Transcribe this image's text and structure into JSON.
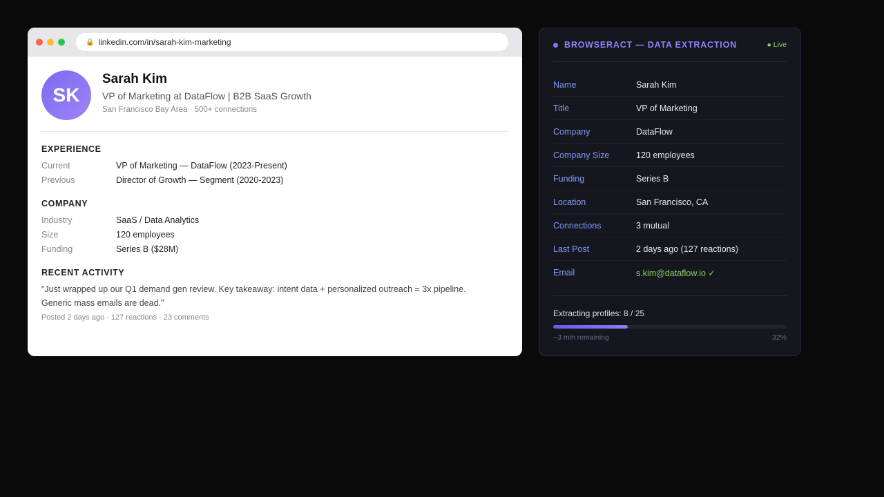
{
  "browser": {
    "url": "linkedin.com/in/sarah-kim-marketing"
  },
  "profile": {
    "initials": "SK",
    "name": "Sarah Kim",
    "headline": "VP of Marketing at DataFlow | B2B SaaS Growth",
    "meta": "San Francisco Bay Area · 500+ connections"
  },
  "experience": {
    "title": "EXPERIENCE",
    "rows": [
      {
        "label": "Current",
        "value": "VP of Marketing — DataFlow (2023-Present)"
      },
      {
        "label": "Previous",
        "value": "Director of Growth — Segment (2020-2023)"
      }
    ]
  },
  "company": {
    "title": "COMPANY",
    "rows": [
      {
        "label": "Industry",
        "value": "SaaS / Data Analytics"
      },
      {
        "label": "Size",
        "value": "120 employees"
      },
      {
        "label": "Funding",
        "value": "Series B ($28M)"
      }
    ]
  },
  "activity": {
    "title": "RECENT ACTIVITY",
    "quote": "\"Just wrapped up our Q1 demand gen review. Key takeaway: intent data + personalized outreach = 3x pipeline. Generic mass emails are dead.\"",
    "meta": "Posted 2 days ago · 127 reactions · 23 comments"
  },
  "panel": {
    "title": "BROWSERACT — DATA EXTRACTION",
    "status": "● Live",
    "fields": [
      {
        "label": "Name",
        "value": "Sarah Kim"
      },
      {
        "label": "Title",
        "value": "VP of Marketing"
      },
      {
        "label": "Company",
        "value": "DataFlow"
      },
      {
        "label": "Company Size",
        "value": "120 employees"
      },
      {
        "label": "Funding",
        "value": "Series B"
      },
      {
        "label": "Location",
        "value": "San Francisco, CA"
      },
      {
        "label": "Connections",
        "value": "3 mutual"
      },
      {
        "label": "Last Post",
        "value": "2 days ago (127 reactions)"
      },
      {
        "label": "Email",
        "value": "s.kim@dataflow.io ✓"
      }
    ],
    "progress": {
      "label": "Extracting profiles: 8 / 25",
      "fraction": 0.32,
      "remaining": "~3 min remaining",
      "percent": "32%"
    }
  },
  "colors": {
    "accent": "#8a86f7",
    "field_label": "#7f9cf8",
    "success": "#8ad35a",
    "panel_bg": "#16161f"
  }
}
